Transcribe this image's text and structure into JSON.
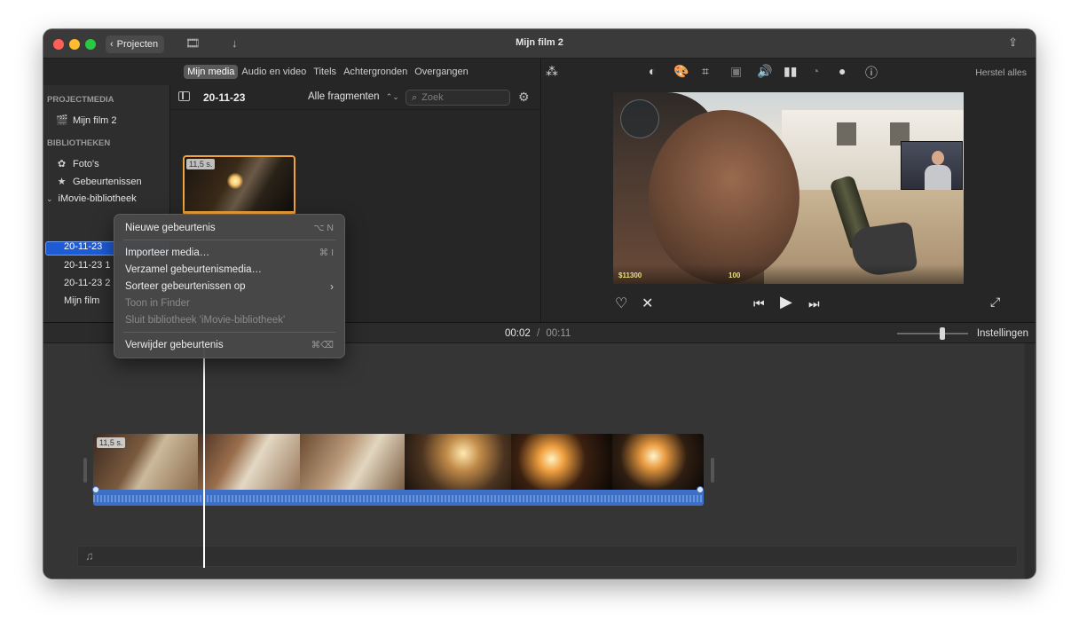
{
  "window": {
    "title": "Mijn film 2",
    "projects_button": "Projecten"
  },
  "browser_tabs": [
    "Mijn media",
    "Audio en video",
    "Titels",
    "Achtergronden",
    "Overgangen"
  ],
  "sidebar": {
    "project_header": "PROJECTMEDIA",
    "project_item": "Mijn film 2",
    "libraries_header": "BIBLIOTHEKEN",
    "photos": "Foto's",
    "events": "Gebeurtenissen",
    "library": "iMovie-bibliotheek",
    "library_items": [
      "20-11-23",
      "20-11-23 1",
      "20-11-23 2",
      "Mijn film"
    ]
  },
  "browser": {
    "event_date": "20-11-23",
    "filter": "Alle fragmenten",
    "search_placeholder": "Zoek",
    "clip_duration": "11,5 s."
  },
  "viewer": {
    "reset_all": "Herstel alles",
    "hud_money": "$11300",
    "hud_number": "100"
  },
  "timeline": {
    "current_time": "00:02",
    "separator": "/",
    "total_time": "00:11",
    "settings": "Instellingen",
    "clip_duration": "11,5 s."
  },
  "context_menu": {
    "new_event": "Nieuwe gebeurtenis",
    "new_event_shortcut": "⌥ N",
    "import_media": "Importeer media…",
    "import_shortcut": "⌘ I",
    "consolidate": "Verzamel gebeurtenismedia…",
    "sort_events": "Sorteer gebeurtenissen op",
    "show_in_finder": "Toon in Finder",
    "close_library": "Sluit bibliotheek 'iMovie-bibliotheek'",
    "delete_event": "Verwijder gebeurtenis",
    "delete_shortcut": "⌘⌫"
  },
  "colors": {
    "selection": "#1e5cd6",
    "clip_border": "#f0a33a",
    "audio_track": "#3d6fc7"
  }
}
